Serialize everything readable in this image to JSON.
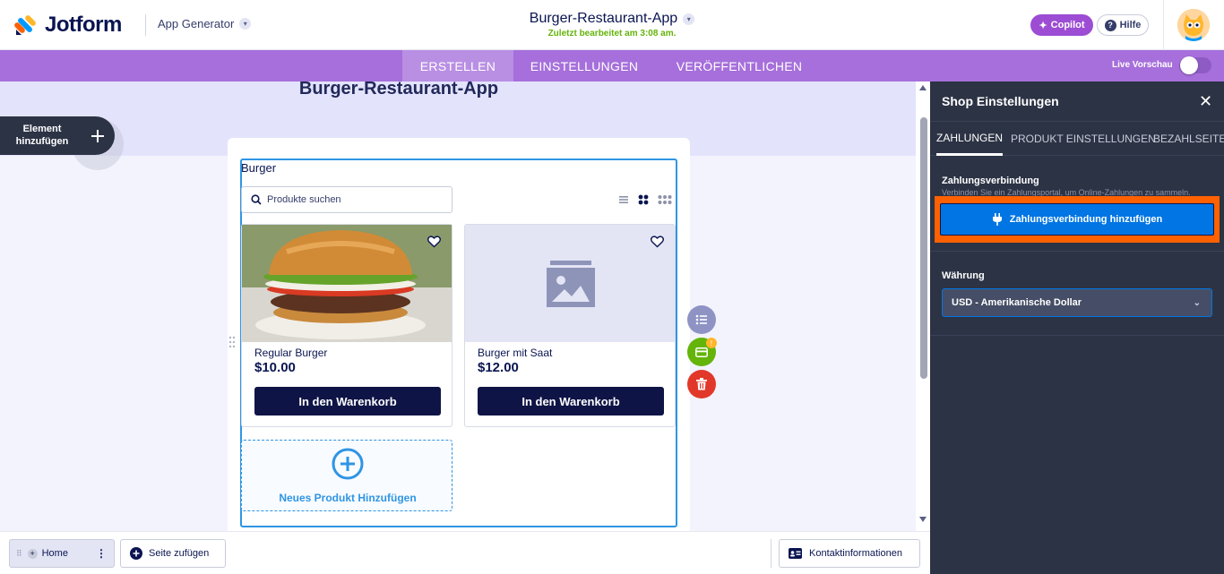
{
  "header": {
    "brand": "Jotform",
    "app_generator": "App Generator",
    "app_title": "Burger-Restaurant-App",
    "last_edited": "Zuletzt bearbeitet am 3:08 am.",
    "copilot_label": "Copilot",
    "help_label": "Hilfe"
  },
  "nav": {
    "tabs": [
      "ERSTELLEN",
      "EINSTELLUNGEN",
      "VERÖFFENTLICHEN"
    ],
    "active_tab": "ERSTELLEN",
    "live_preview_label": "Live Vorschau",
    "live_preview_on": false
  },
  "canvas": {
    "title": "Burger-Restaurant-App",
    "add_element_label": "Element hinzufügen",
    "widget_heading": "Burger",
    "search_placeholder": "Produkte suchen",
    "view_modes": [
      "list-view",
      "grid-view-2",
      "grid-view-3"
    ],
    "products": [
      {
        "name": "Regular Burger",
        "price": "$10.00",
        "cart_label": "In den Warenkorb",
        "image": "burger-photo"
      },
      {
        "name": "Burger mit Saat",
        "price": "$12.00",
        "cart_label": "In den Warenkorb",
        "image": "image-placeholder"
      }
    ],
    "add_product_label": "Neues Produkt Hinzufügen",
    "action_badge": "!"
  },
  "bottom": {
    "home_label": "Home",
    "add_page_label": "Seite zufügen",
    "contact_label": "Kontaktinformationen"
  },
  "panel": {
    "title": "Shop Einstellungen",
    "tabs": [
      "ZAHLUNGEN",
      "PRODUKT EINSTELLUNGEN",
      "BEZAHLSEITE"
    ],
    "active_tab": "ZAHLUNGEN",
    "payment_section_label": "Zahlungsverbindung",
    "payment_section_desc": "Verbinden Sie ein Zahlungsportal, um Online-Zahlungen zu sammeln.",
    "payment_button_label": "Zahlungsverbindung hinzufügen",
    "currency_label": "Währung",
    "currency_value": "USD - Amerikanische Dollar"
  },
  "colors": {
    "brand_navy": "#0a1551",
    "nav_purple": "#a66fdb",
    "panel_bg": "#2c3345",
    "accent_blue": "#0075e3",
    "highlight_orange": "#ff6100",
    "copilot_purple": "#9c4dd3"
  }
}
